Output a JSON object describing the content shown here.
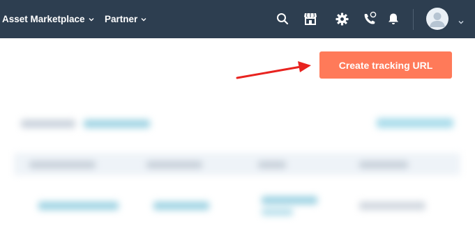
{
  "topbar": {
    "nav": [
      {
        "label": "Asset Marketplace"
      },
      {
        "label": "Partner"
      }
    ],
    "icons": [
      "search-icon",
      "marketplace-store-icon",
      "gear-icon",
      "calling-icon",
      "notifications-bell-icon",
      "avatar",
      "chevron-down-icon"
    ]
  },
  "actions": {
    "create_tracking_url": "Create tracking URL"
  },
  "annotation": {
    "arrow_color": "#e8231f"
  },
  "colors": {
    "topbar_bg": "#2d3e50",
    "primary_button": "#ff7a59",
    "link_blue": "#0091ae"
  }
}
